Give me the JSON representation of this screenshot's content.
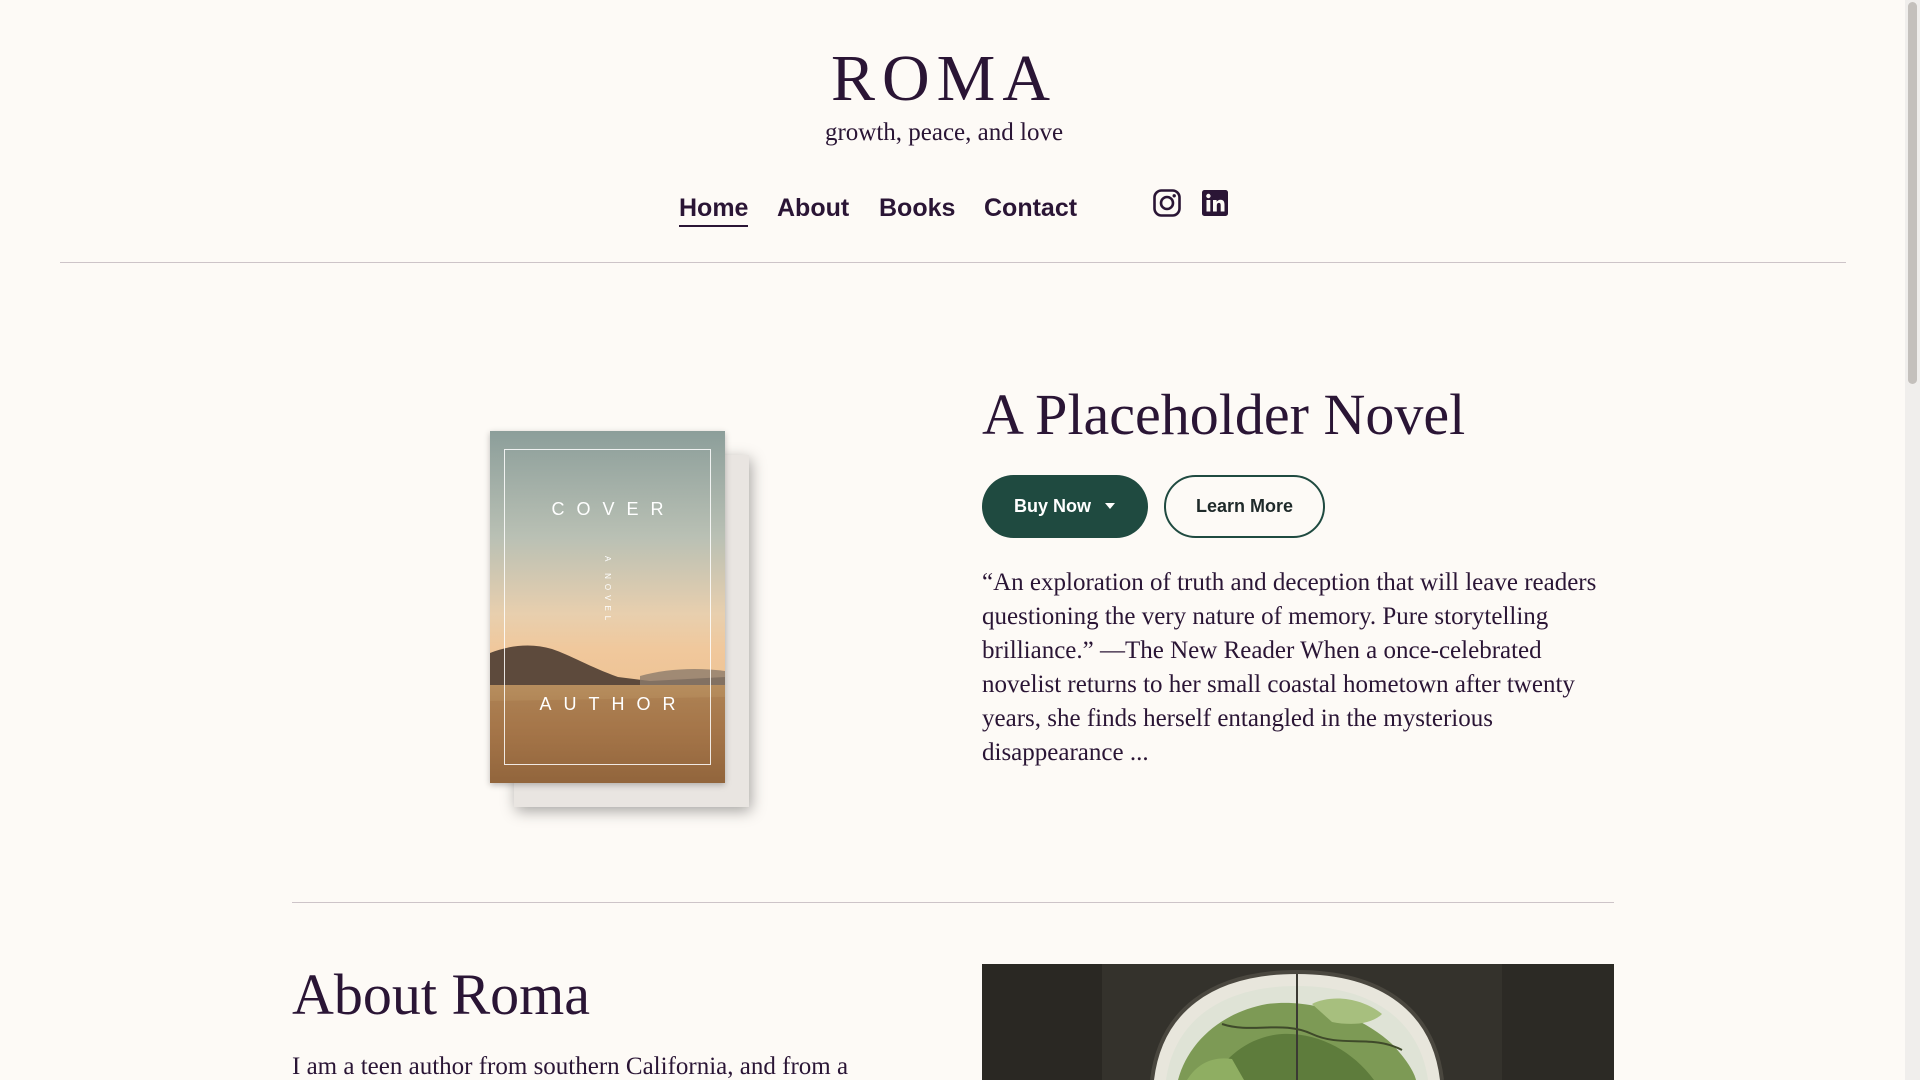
{
  "site": {
    "title": "ROMA",
    "tagline": "growth, peace, and love"
  },
  "nav": {
    "items": [
      {
        "label": "Home",
        "active": true
      },
      {
        "label": "About",
        "active": false
      },
      {
        "label": "Books",
        "active": false
      },
      {
        "label": "Contact",
        "active": false
      }
    ],
    "social": [
      "instagram-icon",
      "linkedin-icon"
    ]
  },
  "book": {
    "cover_title": "COVER",
    "cover_subtitle": "A NOVEL",
    "cover_author": "AUTHOR",
    "title": "A Placeholder Novel",
    "buy_label": "Buy Now",
    "learn_label": "Learn More",
    "description": "“An exploration of truth and deception that will leave readers questioning the very nature of memory. Pure storytelling brilliance.” —The New Reader When a once-celebrated novelist returns to her small coastal hometown after twenty years, she finds herself entangled in the mysterious disappearance ..."
  },
  "about": {
    "title": "About Roma",
    "text": "I am a teen author from southern California, and from a"
  },
  "colors": {
    "background": "#fdfaf6",
    "text": "#2a1535",
    "accent": "#1f4a40",
    "divider": "#cdc4c8"
  }
}
